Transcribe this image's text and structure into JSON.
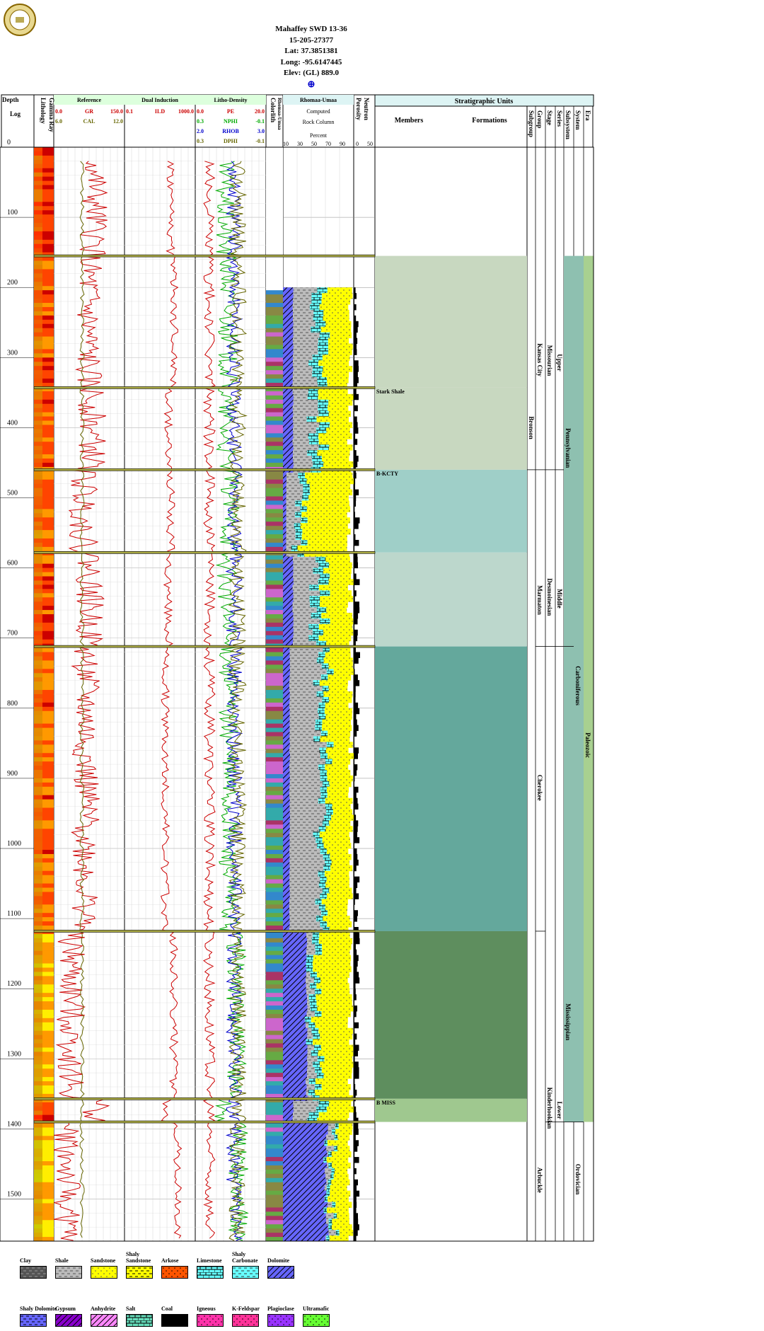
{
  "header": {
    "well_name": "Mahaffey SWD 13-36",
    "api": "15-205-27377",
    "lat": "Lat: 37.3851381",
    "long": "Long: -95.6147445",
    "elev": "Elev: (GL) 889.0",
    "crosshair": "⊕"
  },
  "logo": "KANSAS GEOLOGICAL SURVEY",
  "tracks": {
    "depth": {
      "title1": "Depth",
      "title2": "Log"
    },
    "lithology": {
      "title": "Lithology"
    },
    "gamma": {
      "title": "Gamma Ray"
    },
    "reference": {
      "title": "Reference",
      "gr": "GR",
      "gr_min": "0.0",
      "gr_max": "150.0",
      "cal": "CAL",
      "cal_min": "6.0",
      "cal_max": "12.0"
    },
    "induction": {
      "title": "Dual Induction",
      "ild": "ILD",
      "min": "0.1",
      "max": "1000.0"
    },
    "density": {
      "title": "Litho-Density",
      "pe": "PE",
      "pe_min": "0.0",
      "pe_max": "20.0",
      "nphi": "NPHI",
      "nphi_min": "0.3",
      "nphi_max": "-0.1",
      "rhob": "RHOB",
      "rhob_min": "2.0",
      "rhob_max": "3.0",
      "dphi": "DPHI",
      "dphi_min": "0.3",
      "dphi_max": "-0.1"
    },
    "colorlith": {
      "title": "Colorlith",
      "sub": "Rhomaa-Umaa"
    },
    "rock": {
      "title": "Rhomaa-Umaa",
      "l1": "Computed",
      "l2": "Rock Column",
      "l3": "Percent",
      "ticks": [
        "10",
        "30",
        "50",
        "70",
        "90"
      ]
    },
    "porosity": {
      "title1": "Porosity",
      "title2": "Neutron",
      "ticks": [
        "0",
        "50"
      ]
    },
    "strat": {
      "title": "Stratigraphic Units",
      "members": "Members",
      "formations": "Formations",
      "columns": [
        "Subgroup",
        "Group",
        "Stage",
        "Series",
        "Subsystem",
        "System",
        "Era"
      ]
    }
  },
  "depth_ticks": [
    "0",
    "100",
    "200",
    "300",
    "400",
    "500",
    "600",
    "700",
    "800",
    "900",
    "1000",
    "1100",
    "1200",
    "1300",
    "1400",
    "1500"
  ],
  "tops": [
    {
      "label": "",
      "depth": 155
    },
    {
      "label": "Stark Shale",
      "depth": 343
    },
    {
      "label": "B-KCTY",
      "depth": 460
    },
    {
      "label": "",
      "depth": 578
    },
    {
      "label": "",
      "depth": 712
    },
    {
      "label": "",
      "depth": 1118
    },
    {
      "label": "B MISS",
      "depth": 1357
    },
    {
      "label": "",
      "depth": 1390
    }
  ],
  "strat_units": [
    {
      "column": "Group",
      "text": "Kansas City",
      "top": 155,
      "base": 460
    },
    {
      "column": "Subgroup",
      "text": "Bronson",
      "top": 343,
      "base": 460
    },
    {
      "column": "Stage",
      "text": "Missourian",
      "top": 155,
      "base": 460
    },
    {
      "column": "Series",
      "text": "Upper",
      "top": 155,
      "base": 460
    },
    {
      "column": "Subsystem",
      "text": "Pennsylvanian",
      "top": 155,
      "base": 712
    },
    {
      "column": "Group",
      "text": "Marmaton",
      "top": 578,
      "base": 712
    },
    {
      "column": "Stage",
      "text": "Desmoinesian",
      "top": 578,
      "base": 712
    },
    {
      "column": "Series",
      "text": "Middle",
      "top": 578,
      "base": 712
    },
    {
      "column": "Group",
      "text": "Cherokee",
      "top": 712,
      "base": 1118
    },
    {
      "column": "System",
      "text": "Carboniferous",
      "top": 155,
      "base": 1390
    },
    {
      "column": "Era",
      "text": "Paleozoic",
      "top": 155,
      "base": 1560
    },
    {
      "column": "Subsystem",
      "text": "Mississippian",
      "top": 1118,
      "base": 1390
    },
    {
      "column": "Group",
      "text": "Arbuckle",
      "top": 1390,
      "base": 1560
    },
    {
      "column": "Stage",
      "text": "Kinderhookian",
      "top": 1357,
      "base": 1390
    },
    {
      "column": "Series",
      "text": "Lower",
      "top": 1357,
      "base": 1390
    },
    {
      "column": "System",
      "text": "Ordovician",
      "top": 1390,
      "base": 1560
    }
  ],
  "legend": [
    {
      "label": "Clay",
      "color": "#555555",
      "pattern": "clay"
    },
    {
      "label": "Shale",
      "color": "#bbbbbb",
      "pattern": "shale"
    },
    {
      "label": "Sandstone",
      "color": "#ffff00",
      "pattern": "sand"
    },
    {
      "label": "Shaly Sandstone",
      "color": "#ffff00",
      "pattern": "shalysand"
    },
    {
      "label": "Arkose",
      "color": "#ff5500",
      "pattern": "arkose"
    },
    {
      "label": "Limestone",
      "color": "#66ffff",
      "pattern": "lime"
    },
    {
      "label": "Shaly Carbonate",
      "color": "#66ffff",
      "pattern": "shalycarb"
    },
    {
      "label": "Dolomite",
      "color": "#6666ff",
      "pattern": "dolo"
    },
    {
      "label": "Shaly Dolomite",
      "color": "#6666ff",
      "pattern": "shalydolo"
    },
    {
      "label": "Gypsum",
      "color": "#8800cc",
      "pattern": "gyp"
    },
    {
      "label": "Anhydrite",
      "color": "#ff88ff",
      "pattern": "anhy"
    },
    {
      "label": "Salt",
      "color": "#66ddbb",
      "pattern": "salt"
    },
    {
      "label": "Coal",
      "color": "#000000",
      "pattern": "coal"
    },
    {
      "label": "Igneous",
      "color": "#ff33aa",
      "pattern": "ign"
    },
    {
      "label": "K-Feldspar",
      "color": "#ff3399",
      "pattern": "kspar"
    },
    {
      "label": "Plagioclase",
      "color": "#9933ff",
      "pattern": "plag"
    },
    {
      "label": "Ultramafic",
      "color": "#66ff33",
      "pattern": "ultra"
    }
  ],
  "chart_data": {
    "type": "line",
    "title": "Mahaffey SWD 13-36",
    "ylabel": "Depth",
    "ylim": [
      0,
      1560
    ],
    "zones": [
      {
        "top": 0,
        "base": 155,
        "gr": 95,
        "ild": 40,
        "rock": "shale"
      },
      {
        "top": 155,
        "base": 343,
        "gr": 80,
        "ild": 60,
        "rock": "sand-lime"
      },
      {
        "top": 343,
        "base": 460,
        "gr": 90,
        "ild": 30,
        "rock": "mixed"
      },
      {
        "top": 460,
        "base": 578,
        "gr": 70,
        "ild": 40,
        "rock": "sand"
      },
      {
        "top": 578,
        "base": 712,
        "gr": 85,
        "ild": 30,
        "rock": "mixed"
      },
      {
        "top": 712,
        "base": 1118,
        "gr": 75,
        "ild": 20,
        "rock": "shale-sand"
      },
      {
        "top": 1118,
        "base": 1357,
        "gr": 40,
        "ild": 60,
        "rock": "sand-dolo"
      },
      {
        "top": 1357,
        "base": 1390,
        "gr": 100,
        "ild": 20,
        "rock": "mixed"
      },
      {
        "top": 1390,
        "base": 1560,
        "gr": 30,
        "ild": 100,
        "rock": "dolo"
      }
    ]
  }
}
